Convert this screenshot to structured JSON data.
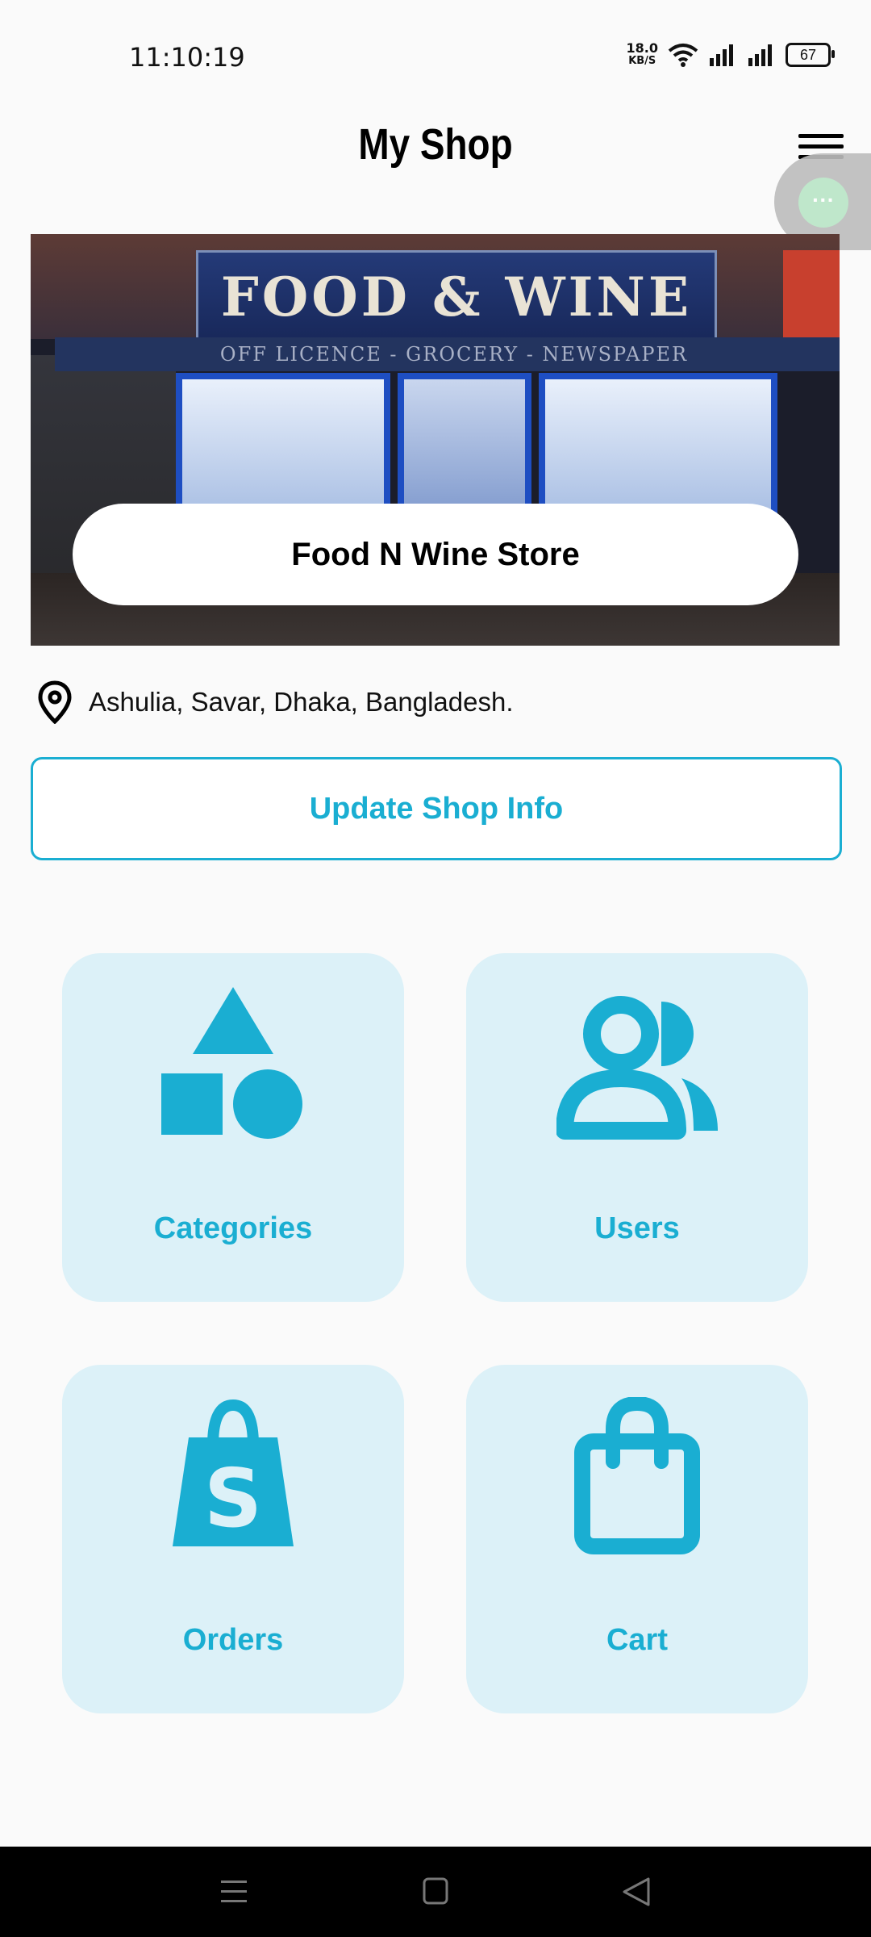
{
  "status_bar": {
    "time": "11:10:19",
    "net_speed_value": "18.0",
    "net_speed_unit": "KB/S",
    "battery": "67"
  },
  "header": {
    "title": "My Shop",
    "menu_icon": "hamburger-menu-icon"
  },
  "floating_bubble": {
    "icon": "more-dots-icon",
    "glyph": "···"
  },
  "banner": {
    "sign_text": "FOOD & WINE",
    "sub_sign_text": "OFF LICENCE - GROCERY - NEWSPAPER",
    "shop_name": "Food N Wine Store"
  },
  "address": {
    "icon": "location-pin-icon",
    "text": "Ashulia, Savar, Dhaka, Bangladesh."
  },
  "update_button": {
    "label": "Update Shop Info"
  },
  "tiles": [
    {
      "label": "Categories",
      "icon": "shapes-icon"
    },
    {
      "label": "Users",
      "icon": "users-icon"
    },
    {
      "label": "Orders",
      "icon": "shopping-bag-s-icon"
    },
    {
      "label": "Cart",
      "icon": "bag-icon"
    }
  ],
  "nav_bar": {
    "items": [
      "menu-lines-icon",
      "home-square-icon",
      "back-triangle-icon"
    ]
  },
  "colors": {
    "accent": "#1aaed2",
    "tile_bg": "#dcf1f8",
    "nav_bg": "#000000"
  }
}
